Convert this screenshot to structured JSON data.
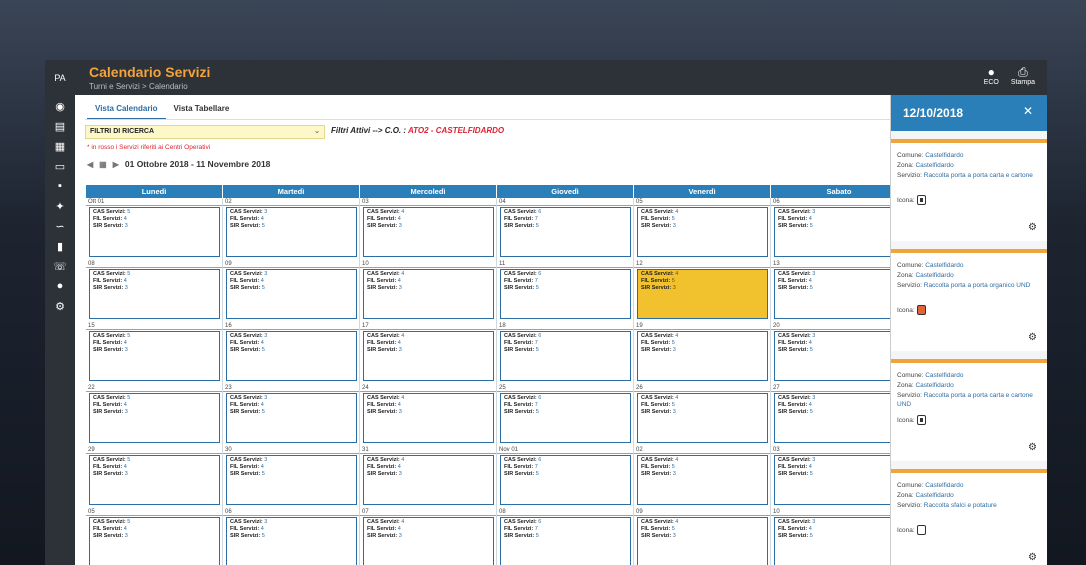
{
  "app": {
    "title": "Calendario Servizi",
    "breadcrumb": "Turni e Servizi  >  Calendario",
    "logo_text": "PA",
    "top_icons": [
      {
        "name": "user-icon",
        "label": "ECO"
      },
      {
        "name": "print-icon",
        "label": "Stampa"
      }
    ]
  },
  "tabs": [
    {
      "label": "Vista Calendario",
      "active": true
    },
    {
      "label": "Vista Tabellare",
      "active": false
    }
  ],
  "filters": {
    "select_value": "FILTRI DI RICERCA",
    "active_prefix": "Filtri Attivi  -->  C.O. :",
    "active_value": "ATO2 - CASTELFIDARDO",
    "note": "* in rosso i Servizi riferiti ai Centri Operativi"
  },
  "period": "01 Ottobre 2018 - 11 Novembre 2018",
  "calendar": {
    "weekdays": [
      "Lunedì",
      "Martedì",
      "Mercoledì",
      "Giovedì",
      "Venerdì",
      "Sabato"
    ],
    "labels": {
      "cas": "CAS Servizi:",
      "fil": "FIL Servizi:",
      "sir": "SIR Servizi:"
    },
    "weeks": [
      [
        "Ott 01",
        "02",
        "03",
        "04",
        "05",
        "06"
      ],
      [
        "08",
        "09",
        "10",
        "11",
        "12",
        "13"
      ],
      [
        "15",
        "16",
        "17",
        "18",
        "19",
        "20"
      ],
      [
        "22",
        "23",
        "24",
        "25",
        "26",
        "27"
      ],
      [
        "29",
        "30",
        "31",
        "Nov 01",
        "02",
        "03"
      ],
      [
        "05",
        "06",
        "07",
        "08",
        "09",
        "10"
      ]
    ],
    "counts_by_weekday": [
      {
        "cas": "5",
        "fil": "4",
        "sir": "3"
      },
      {
        "cas": "3",
        "fil": "4",
        "sir": "5"
      },
      {
        "cas": "4",
        "fil": "4",
        "sir": "3"
      },
      {
        "cas": "6",
        "fil": "7",
        "sir": "5"
      },
      {
        "cas": "4",
        "fil": "5",
        "sir": "3"
      },
      {
        "cas": "3",
        "fil": "4",
        "sir": "5"
      }
    ],
    "highlight": {
      "week": 1,
      "day": 4,
      "color": "#f2c12e"
    }
  },
  "panel": {
    "date": "12/10/2018",
    "labels": {
      "comune": "Comune:",
      "zona": "Zona:",
      "servizio": "Servizio:",
      "icona": "Icona:"
    },
    "cards": [
      {
        "comune": "Castelfidardo",
        "zona": "Castelfidardo",
        "servizio": "Raccolta porta a porta carta e cartone",
        "icon": "dark-bin-icon"
      },
      {
        "comune": "Castelfidardo",
        "zona": "Castelfidardo",
        "servizio": "Raccolta porta a porta organico UND",
        "icon": "red-bin-icon"
      },
      {
        "comune": "Castelfidardo",
        "zona": "Castelfidardo",
        "servizio": "Raccolta porta a porta carta e cartone UND",
        "icon": "dark-bin-icon"
      },
      {
        "comune": "Castelfidardo",
        "zona": "Castelfidardo",
        "servizio": "Raccolta sfalci e potature",
        "icon": "bin-icon"
      }
    ]
  },
  "colors": {
    "accent": "#2b7fb8",
    "title": "#f2a33a",
    "card_border": "#f0a43c",
    "note_red": "#dd2233"
  }
}
